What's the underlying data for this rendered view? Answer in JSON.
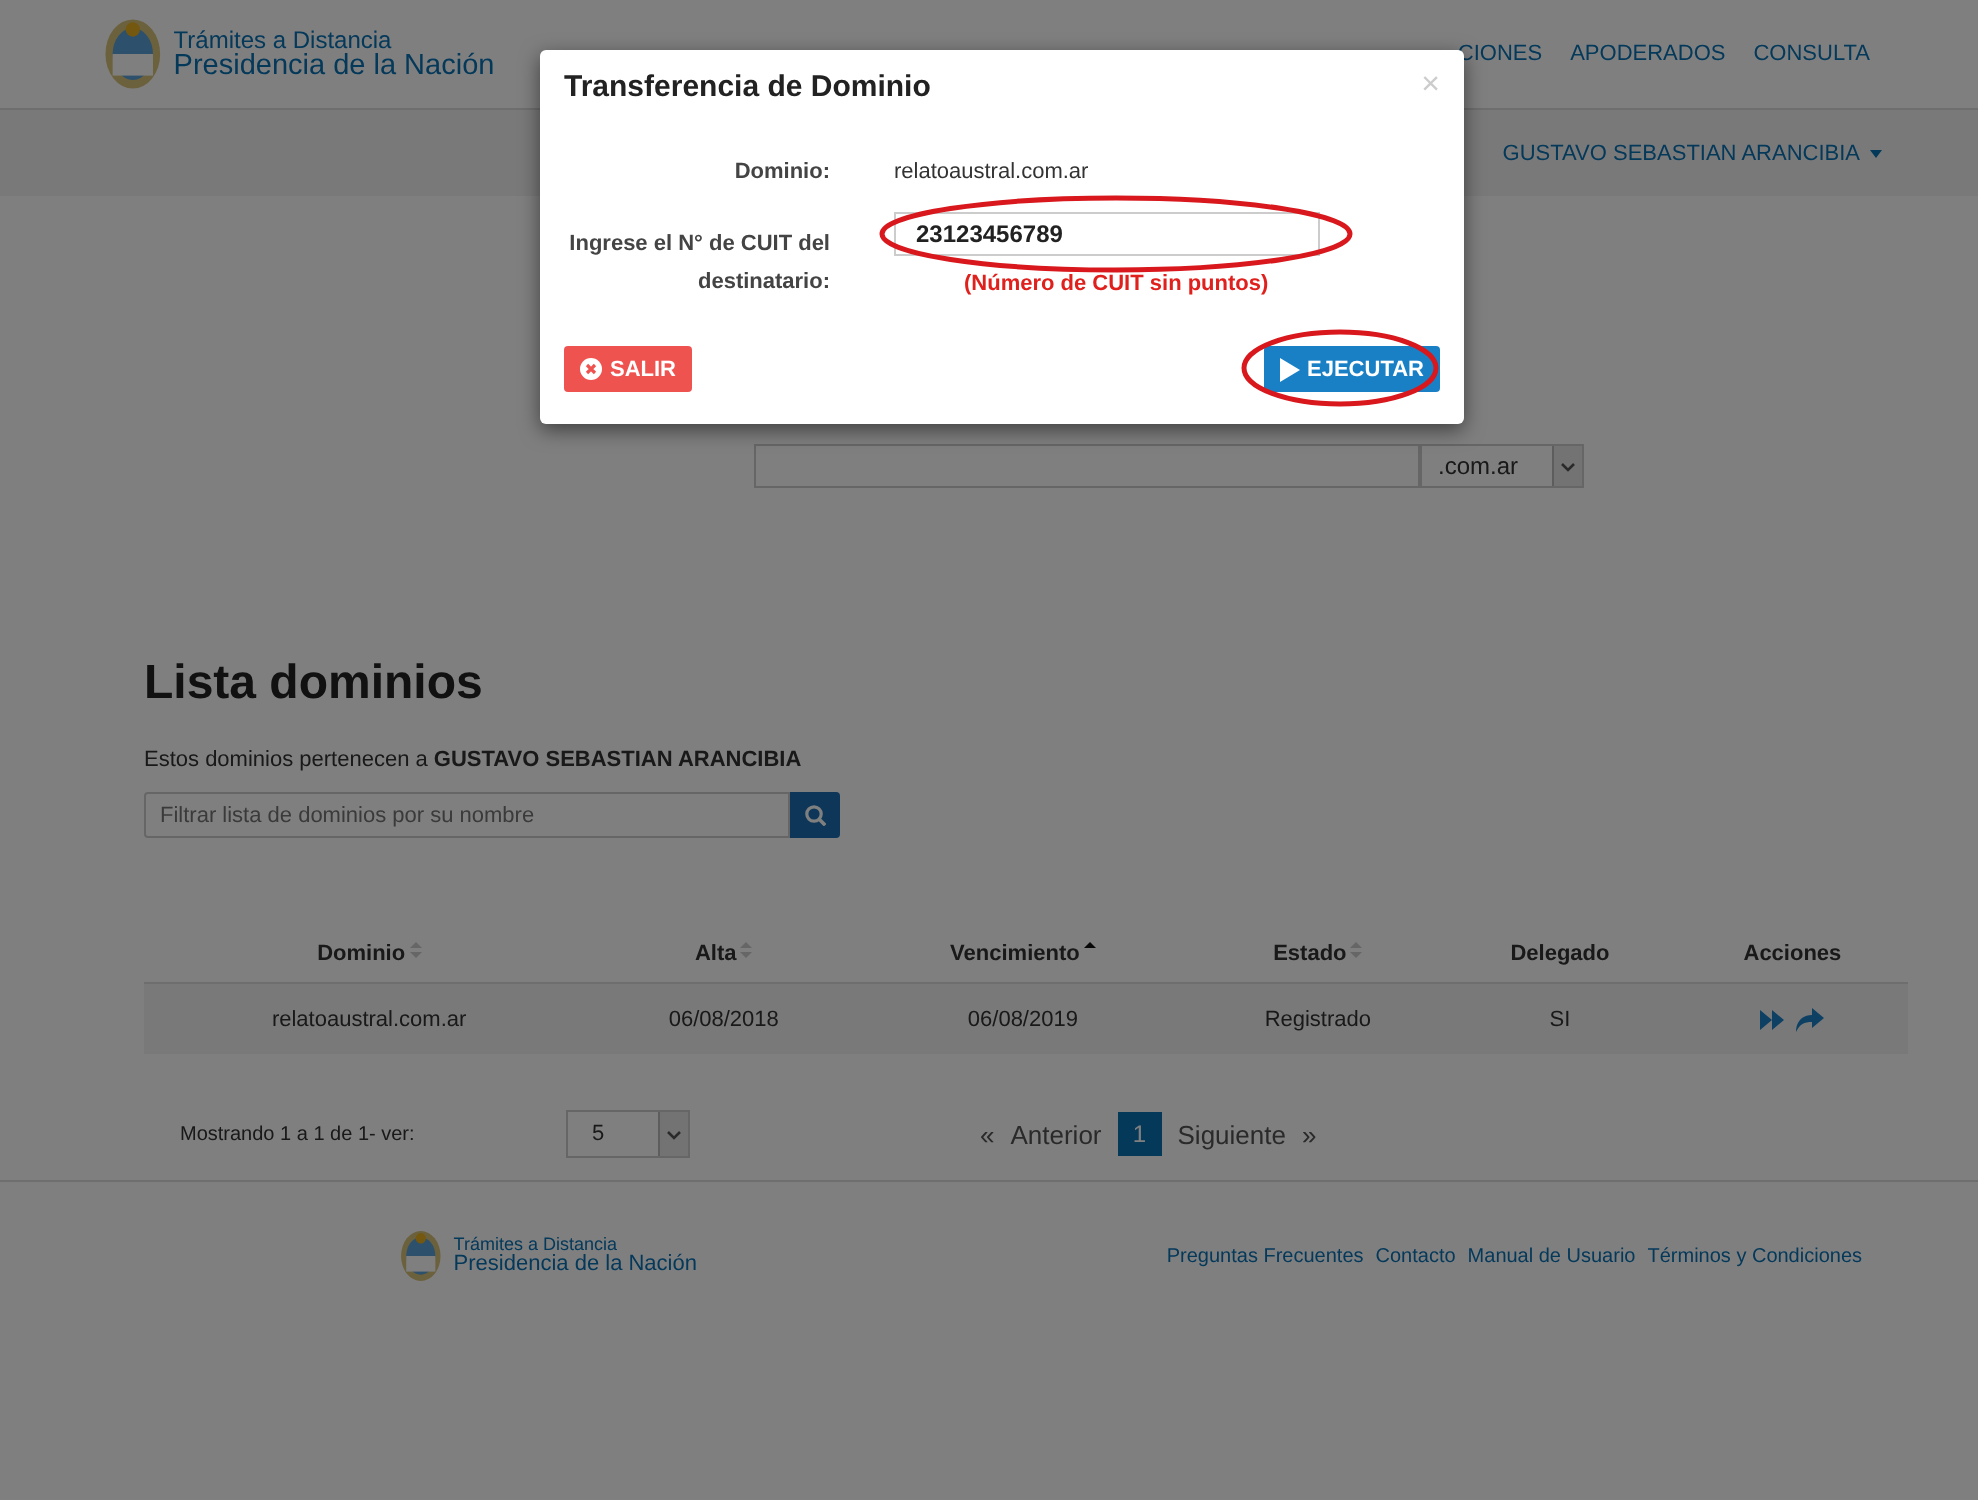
{
  "header": {
    "logo": {
      "line1": "Trámites a Distancia",
      "line2": "Presidencia de la Nación"
    },
    "nav": [
      {
        "label": "CIONES"
      },
      {
        "label": "APODERADOS"
      },
      {
        "label": "CONSULTA"
      }
    ]
  },
  "user_menu": {
    "label": "GUSTAVO SEBASTIAN ARANCIBIA"
  },
  "search": {
    "extension": ".com.ar"
  },
  "list": {
    "title": "Lista dominios",
    "description": "Estos dominios pertenecen a **GUSTAVO SEBASTIAN ARANCIBIA**",
    "filter_placeholder": "Filtrar lista de dominios por su nombre"
  },
  "table": {
    "columns": [
      {
        "label": "Dominio",
        "sortable": true,
        "sorted": false
      },
      {
        "label": "Alta",
        "sortable": true,
        "sorted": false
      },
      {
        "label": "Vencimiento",
        "sortable": true,
        "sorted": true
      },
      {
        "label": "Estado",
        "sortable": true,
        "sorted": false
      },
      {
        "label": "Delegado",
        "sortable": false
      },
      {
        "label": "Acciones",
        "sortable": false
      }
    ],
    "rows": [
      {
        "cells": [
          "relatoaustral.com.ar",
          "06/08/2018",
          "06/08/2019",
          "Registrado",
          "SI"
        ]
      }
    ]
  },
  "pagination": {
    "summary": "Mostrando 1 a 1 de 1- ver:",
    "page_size": "5",
    "prev_icon": "«",
    "prev_label": "Anterior",
    "pages": [
      {
        "label": "1",
        "selected": true
      }
    ],
    "next_label": "Siguiente",
    "next_icon": "»"
  },
  "footer": {
    "logo": {
      "line1": "Trámites a Distancia",
      "line2": "Presidencia de la Nación"
    },
    "links": [
      "Preguntas Frecuentes",
      "Contacto",
      "Manual de Usuario",
      "Términos y Condiciones"
    ]
  },
  "modal": {
    "title": "Transferencia de Dominio",
    "close": "×",
    "domain_label": "Dominio:",
    "domain_value": "relatoaustral.com.ar",
    "cuit_label": "Ingrese el N° de CUIT del destinatario:",
    "cuit_value": "23123456789",
    "cuit_highlighted": true,
    "hint": "(Número de CUIT sin puntos)",
    "buttons": [
      {
        "label": "SALIR",
        "kind": "danger",
        "highlighted": false
      },
      {
        "label": "EJECUTAR",
        "kind": "primary",
        "highlighted": true
      }
    ]
  }
}
